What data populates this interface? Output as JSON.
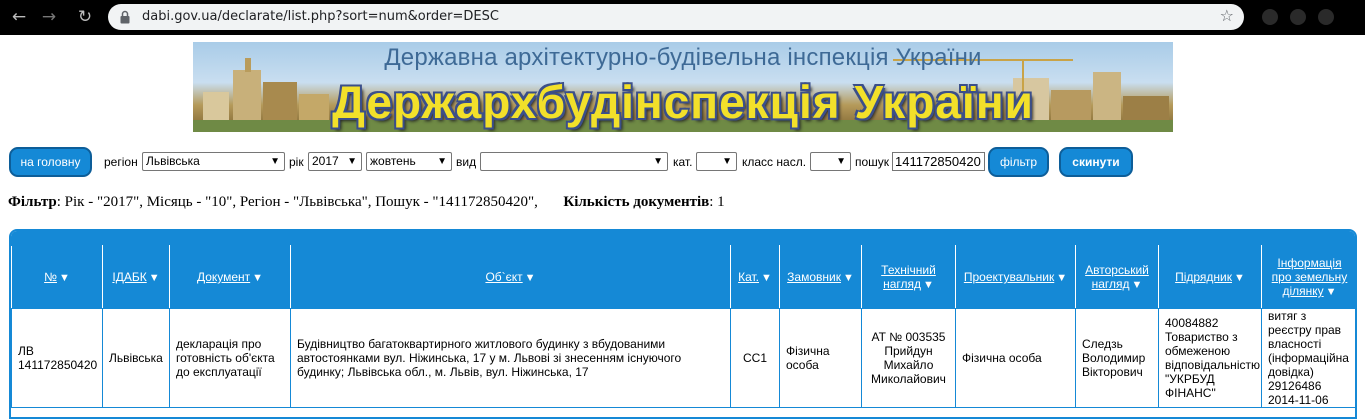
{
  "browser": {
    "url": "dabi.gov.ua/declarate/list.php?sort=num&order=DESC"
  },
  "banner": {
    "subtitle": "Державна архітектурно-будівельна інспекція України",
    "title": "Держархбудінспекція України"
  },
  "filter_bar": {
    "home_button": "на головну",
    "region_label": "регіон",
    "region_value": "Львівська",
    "year_label": "рік",
    "year_value": "2017",
    "month_value": "жовтень",
    "type_label": "вид",
    "type_value": "",
    "category_label": "кат.",
    "category_value": "",
    "class_label": "класс насл.",
    "class_value": "",
    "search_label": "пошук",
    "search_value": "141172850420",
    "filter_button": "фільтр",
    "reset_button": "скинути"
  },
  "summary": {
    "filter_label": "Фільтр",
    "filter_text": ": Рік - \"2017\", Місяць - \"10\", Регіон - \"Львівська\", Пошук - \"141172850420\",",
    "count_label": "Кількість документів",
    "count_value": ": 1"
  },
  "table": {
    "headers": [
      {
        "label": "№",
        "sortable": true
      },
      {
        "label": "ІДАБК",
        "sortable": true
      },
      {
        "label": "Документ",
        "sortable": true
      },
      {
        "label": "Об`єкт",
        "sortable": true
      },
      {
        "label": "Кат.",
        "sortable": true
      },
      {
        "label": "Замовник",
        "sortable": true
      },
      {
        "label": "Технічний нагляд",
        "sortable": true
      },
      {
        "label": "Проектувальник",
        "sortable": true
      },
      {
        "label": "Авторський нагляд",
        "sortable": true
      },
      {
        "label": "Підрядник",
        "sortable": true
      },
      {
        "label": "Інформація про земельну ділянку",
        "sortable": true
      }
    ],
    "rows": [
      {
        "num": "ЛВ 141172850420",
        "idabk": "Львівська",
        "document": "декларація про готовність об'єкта до експлуатації",
        "object": "Будівництво багатоквартирного житлового будинку з вбудованими автостоянками вул. Ніжинська, 17 у м. Львові зі знесенням існуючого будинку; Львівська обл., м. Львів, вул. Ніжинська, 17",
        "category": "СС1",
        "customer": "Фізична особа",
        "tech_supervision": "АТ № 003535 Прийдун Михайло Миколайович",
        "designer": "Фізична особа",
        "author_supervision": "Следзь Володимир Вікторович",
        "contractor": "40084882 Товариство з обмеженою відповідальністю \"УКРБУД ФІНАНС\"",
        "land_info": "витяг з реєстру прав власності (інформаційна довідка) 29126486 2014-11-06"
      }
    ]
  },
  "colors": {
    "accent": "#1589d6",
    "banner_title": "#f2e02a",
    "banner_subtitle": "#3e6a96"
  }
}
